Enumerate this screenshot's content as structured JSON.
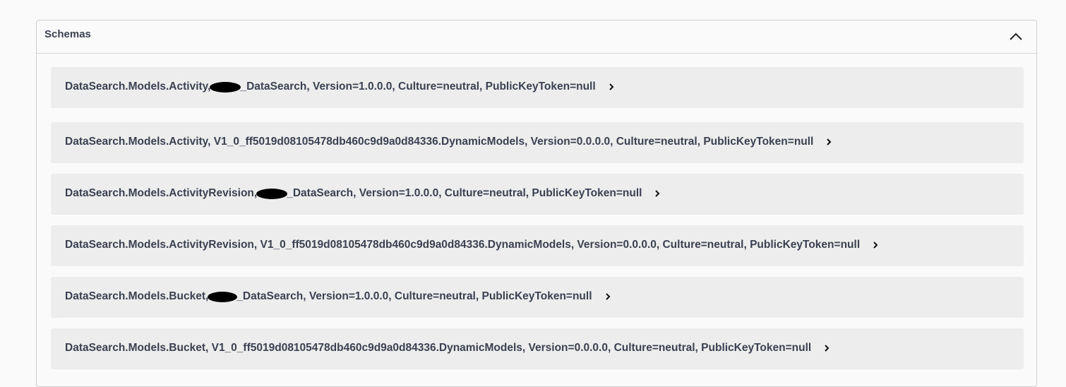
{
  "panel": {
    "title": "Schemas"
  },
  "schemas": [
    {
      "prefix": "DataSearch.Models.Activity,",
      "redacted": true,
      "suffix": "_DataSearch, Version=1.0.0.0, Culture=neutral, PublicKeyToken=null"
    },
    {
      "prefix": "DataSearch.Models.Activity, V1_0_ff5019d08105478db460c9d9a0d84336.DynamicModels, Version=0.0.0.0, Culture=neutral, PublicKeyToken=null",
      "redacted": false,
      "suffix": ""
    },
    {
      "prefix": "DataSearch.Models.ActivityRevision,",
      "redacted": true,
      "suffix": "_DataSearch, Version=1.0.0.0, Culture=neutral, PublicKeyToken=null"
    },
    {
      "prefix": "DataSearch.Models.ActivityRevision, V1_0_ff5019d08105478db460c9d9a0d84336.DynamicModels, Version=0.0.0.0, Culture=neutral, PublicKeyToken=null",
      "redacted": false,
      "suffix": ""
    },
    {
      "prefix": "DataSearch.Models.Bucket,",
      "redacted": true,
      "suffix": "_DataSearch, Version=1.0.0.0, Culture=neutral, PublicKeyToken=null"
    },
    {
      "prefix": "DataSearch.Models.Bucket, V1_0_ff5019d08105478db460c9d9a0d84336.DynamicModels, Version=0.0.0.0, Culture=neutral, PublicKeyToken=null",
      "redacted": false,
      "suffix": ""
    }
  ]
}
